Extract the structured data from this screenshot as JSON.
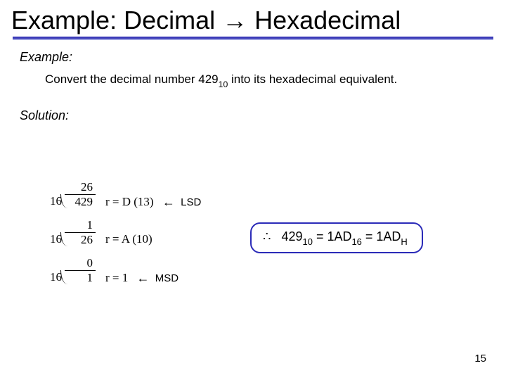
{
  "title": "Example: Decimal → Hexadecimal",
  "labels": {
    "example": "Example:",
    "solution": "Solution:"
  },
  "prompt": {
    "pre": "Convert the decimal number 429",
    "base": "10",
    "post": " into its hexadecimal equivalent."
  },
  "work": [
    {
      "divisor": "16",
      "dividend": "429",
      "quotient": "26",
      "r_label": "r = D (13)",
      "annot": "LSD"
    },
    {
      "divisor": "16",
      "dividend": "26",
      "quotient": "1",
      "r_label": "r = A (10)",
      "annot": ""
    },
    {
      "divisor": "16",
      "dividend": "1",
      "quotient": "0",
      "r_label": "r = 1",
      "annot": "MSD"
    }
  ],
  "result": {
    "therefore": "∴",
    "n": "429",
    "n_base": "10",
    "eq": " = ",
    "v": "1AD",
    "v_base1": "16",
    "v_base2": "H"
  },
  "page": "15"
}
